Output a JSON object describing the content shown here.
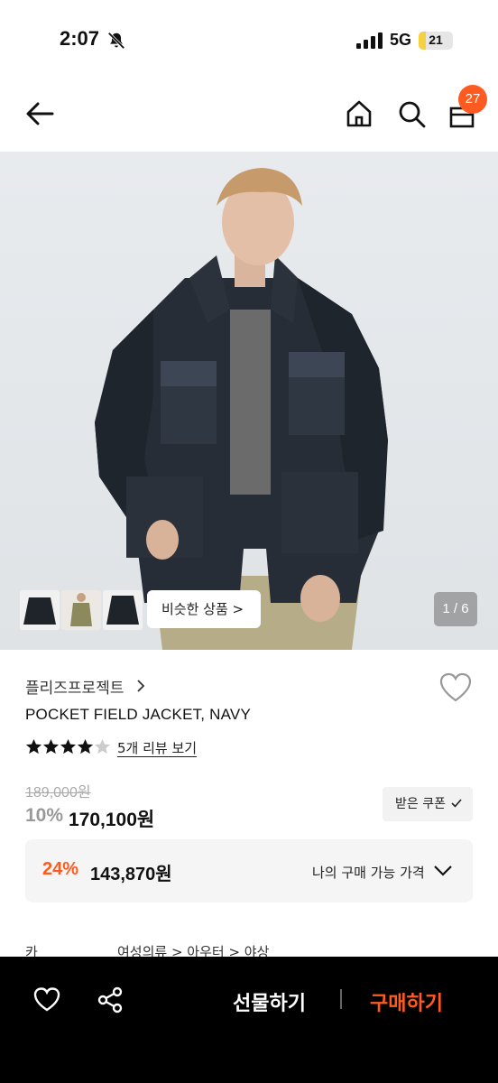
{
  "status_bar": {
    "time": "2:07",
    "network": "5G",
    "battery_level": "21",
    "battery_color": "#f5d142"
  },
  "header": {
    "icons": [
      "back-arrow-icon",
      "home-icon",
      "search-icon",
      "shopping-bag-icon"
    ],
    "cart_count": "27",
    "accent_color": "#ff5a1f"
  },
  "gallery": {
    "similar_label": "비슷한 상품 >",
    "page_indicator": "1 / 6",
    "thumbnails": [
      "thumbnail-navy-jacket-front",
      "thumbnail-model-khaki",
      "thumbnail-navy-jacket-back"
    ]
  },
  "product": {
    "brand": "플리즈프로젝트",
    "name": "POCKET FIELD JACKET, NAVY",
    "rating_stars": 4,
    "rating_max": 5,
    "review_link": "5개 리뷰 보기",
    "original_price": "189,000원",
    "discount_rate": "10%",
    "sale_price": "170,100원",
    "coupon_label": "받은 쿠폰"
  },
  "my_price": {
    "discount_rate": "24%",
    "price": "143,870원",
    "label": "나의 구매 가능 가격"
  },
  "category": {
    "label": "카테고리",
    "path": "여성의류 > 아우터 > 야상"
  },
  "bottom_bar": {
    "gift_label": "선물하기",
    "buy_label": "구매하기"
  }
}
